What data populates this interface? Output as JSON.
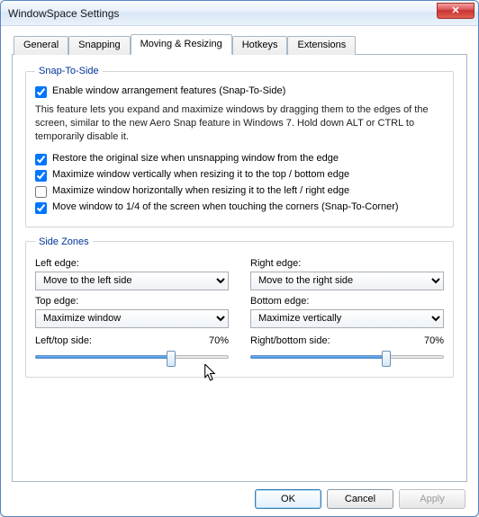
{
  "window": {
    "title": "WindowSpace Settings"
  },
  "tabs": [
    {
      "label": "General"
    },
    {
      "label": "Snapping"
    },
    {
      "label": "Moving & Resizing"
    },
    {
      "label": "Hotkeys"
    },
    {
      "label": "Extensions"
    }
  ],
  "active_tab_index": 2,
  "snap_group": {
    "legend": "Snap-To-Side",
    "enable_label": "Enable window arrangement features (Snap-To-Side)",
    "enable_checked": true,
    "description": "This feature lets you expand and maximize windows by dragging them to the edges of the screen, similar to the new Aero Snap feature in Windows 7. Hold down ALT or CTRL to temporarily disable it.",
    "options": [
      {
        "label": "Restore the original size when unsnapping window from the edge",
        "checked": true
      },
      {
        "label": "Maximize window vertically when resizing it to the top / bottom edge",
        "checked": true
      },
      {
        "label": "Maximize window horizontally when resizing it to the left / right edge",
        "checked": false
      },
      {
        "label": "Move window to 1/4 of the screen when touching the corners (Snap-To-Corner)",
        "checked": true
      }
    ]
  },
  "zones_group": {
    "legend": "Side Zones",
    "left": {
      "edge_label": "Left edge:",
      "edge_value": "Move to the left side",
      "top_label": "Top edge:",
      "top_value": "Maximize window",
      "slider_label": "Left/top side:",
      "slider_value": "70%",
      "slider_percent": 70
    },
    "right": {
      "edge_label": "Right edge:",
      "edge_value": "Move to the right side",
      "bottom_label": "Bottom edge:",
      "bottom_value": "Maximize vertically",
      "slider_label": "Right/bottom side:",
      "slider_value": "70%",
      "slider_percent": 70
    }
  },
  "buttons": {
    "ok": "OK",
    "cancel": "Cancel",
    "apply": "Apply"
  }
}
